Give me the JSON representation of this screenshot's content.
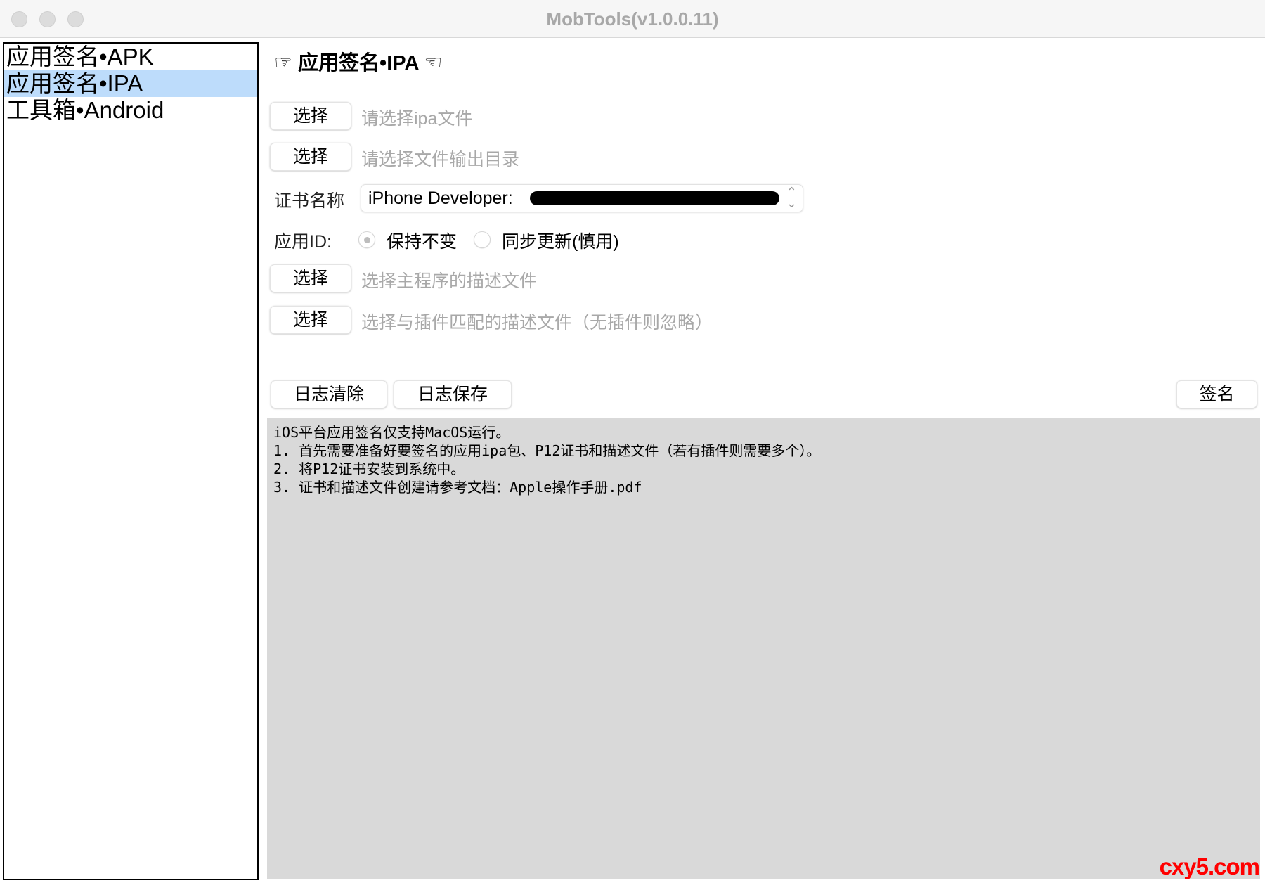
{
  "window": {
    "title": "MobTools(v1.0.0.11)"
  },
  "sidebar": {
    "items": [
      {
        "label": "应用签名•APK"
      },
      {
        "label": "应用签名•IPA",
        "selected": true
      },
      {
        "label": "工具箱•Android"
      }
    ]
  },
  "main": {
    "heading": "☞ 应用签名•IPA ☜",
    "rows": {
      "ipa": {
        "button": "选择",
        "placeholder": "请选择ipa文件"
      },
      "output": {
        "button": "选择",
        "placeholder": "请选择文件输出目录"
      },
      "cert": {
        "label": "证书名称",
        "value": "iPhone Developer:"
      },
      "appid": {
        "label": "应用ID:",
        "options": [
          {
            "label": "保持不变",
            "selected": true
          },
          {
            "label": "同步更新(慎用)",
            "selected": false
          }
        ]
      },
      "profile": {
        "button": "选择",
        "placeholder": "选择主程序的描述文件"
      },
      "plugin_profile": {
        "button": "选择",
        "placeholder": "选择与插件匹配的描述文件（无插件则忽略）"
      }
    },
    "actions": {
      "clear_log": "日志清除",
      "save_log": "日志保存",
      "sign": "签名"
    },
    "log": {
      "lines": [
        "iOS平台应用签名仅支持MacOS运行。",
        "1. 首先需要准备好要签名的应用ipa包、P12证书和描述文件（若有插件则需要多个）。",
        "2. 将P12证书安装到系统中。",
        "3. 证书和描述文件创建请参考文档：Apple操作手册.pdf"
      ]
    }
  },
  "watermark": "cxy5.com"
}
